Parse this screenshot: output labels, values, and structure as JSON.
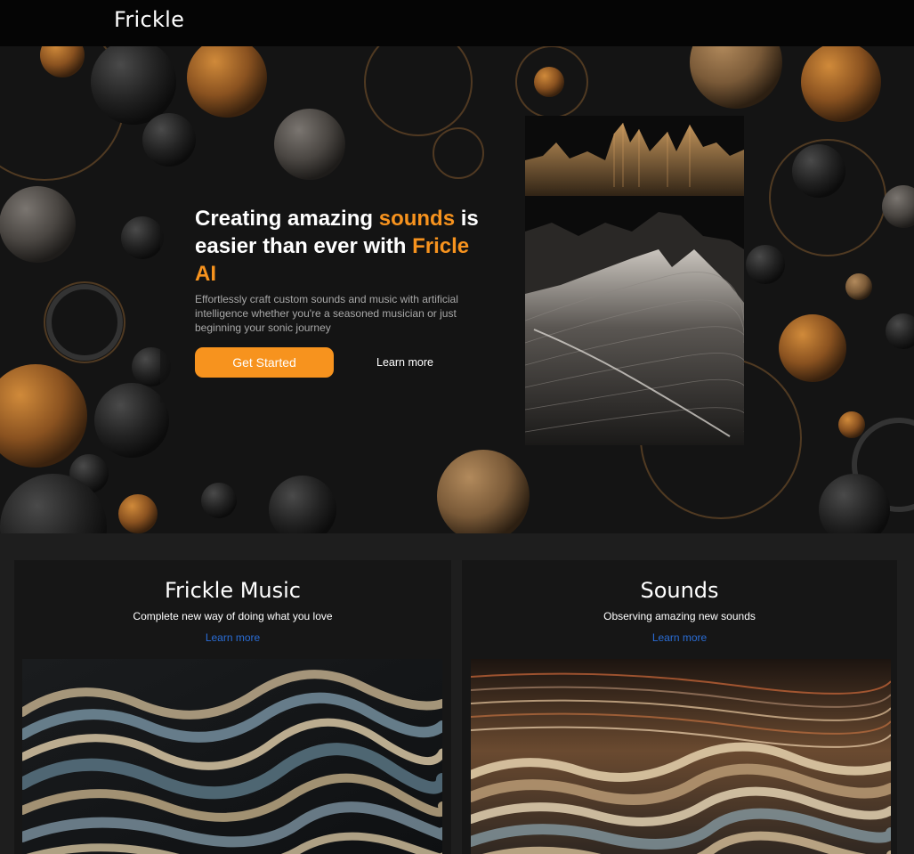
{
  "header": {
    "brand": "Frickle"
  },
  "hero": {
    "title_part1": "Creating amazing ",
    "title_highlight1": "sounds",
    "title_part2": " is easier than ever with ",
    "title_highlight2": "Fricle AI",
    "description": "Effortlessly craft custom sounds and music with artificial intelligence whether you're a seasoned musician or just beginning your sonic journey",
    "primary_button": "Get Started",
    "secondary_button": "Learn more"
  },
  "cards": [
    {
      "title": "Frickle Music",
      "subtitle": "Complete new way of doing what you love",
      "link": "Learn more"
    },
    {
      "title": "Sounds",
      "subtitle": "Observing amazing new sounds",
      "link": "Learn more"
    }
  ],
  "colors": {
    "accent": "#f7931e",
    "link": "#2a6dd6",
    "background": "#1e1e1e",
    "card": "#161616"
  }
}
